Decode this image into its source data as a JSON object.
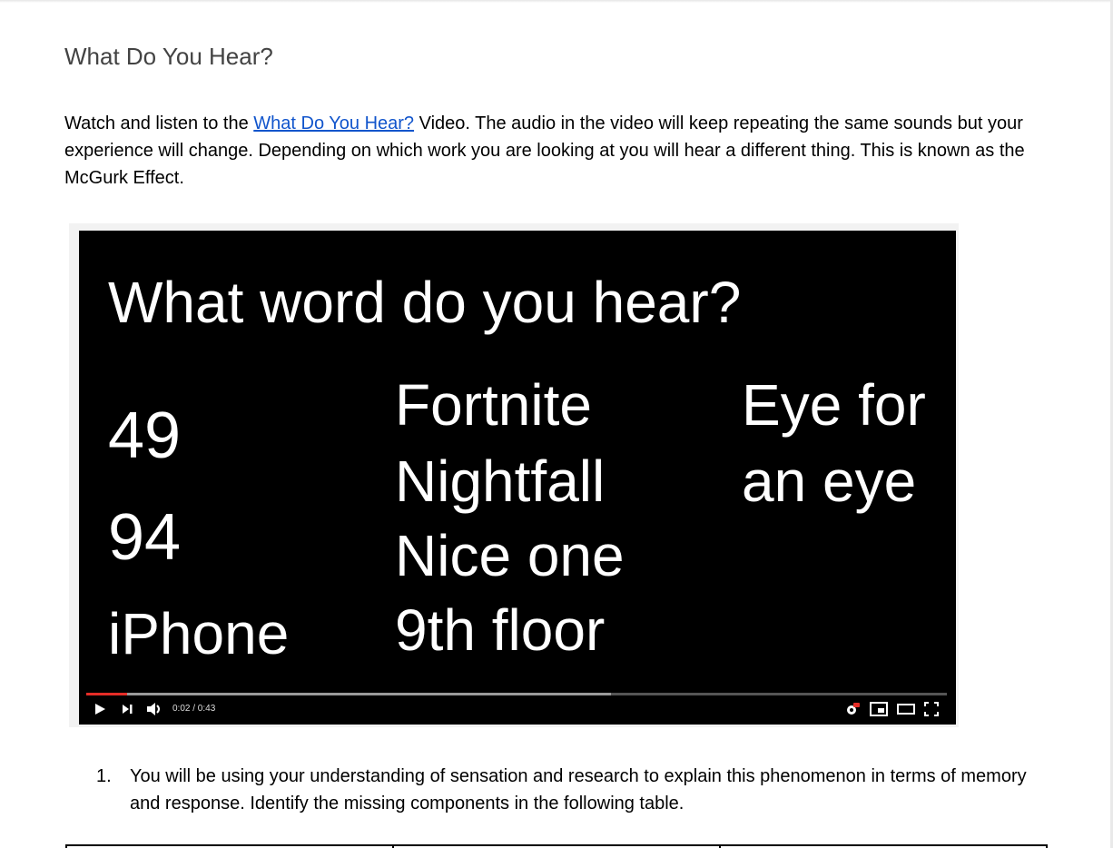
{
  "doc": {
    "heading": "What Do You Hear?",
    "para_before_link": "Watch and listen to the ",
    "link_text": "What Do You Hear?",
    "para_after_link": " Video.  The audio in the video will keep repeating the same sounds but your experience will change.  Depending on which work you are looking at you will hear a different thing.  This is known as the McGurk Effect.",
    "list_number": "1.",
    "list_text": "You will be using your understanding of sensation and research to explain this phenomenon in terms of memory and response.  Identify the missing components in the following table."
  },
  "video": {
    "title": "What word do you hear?",
    "col1": [
      "49",
      "94",
      "iPhone"
    ],
    "col2": [
      "Fortnite",
      "Nightfall",
      "Nice one",
      "9th floor"
    ],
    "col3": [
      "Eye for",
      "an eye"
    ],
    "time": "0:02 / 0:43",
    "progress_played": 0.047,
    "progress_buffered": 0.61,
    "icons": [
      "play-icon",
      "next-icon",
      "volume-icon",
      "settings-icon",
      "miniplayer-icon",
      "theater-icon",
      "fullscreen-icon"
    ]
  }
}
